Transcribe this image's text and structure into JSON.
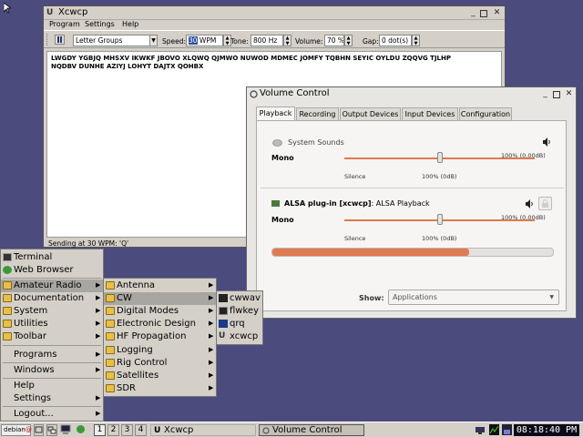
{
  "xcwcp": {
    "title": "Xcwcp",
    "menu": [
      "Program",
      "Settings",
      "Help"
    ],
    "toolbar": {
      "mode": "Letter Groups",
      "speed_label": "Speed:",
      "speed_value": "30 WPM",
      "tone_label": "Tone:",
      "tone_value": "800 Hz",
      "volume_label": "Volume:",
      "volume_value": "70 %",
      "gap_label": "Gap:",
      "gap_value": "0 dot(s)"
    },
    "text_line1": "LWGDY YGBJQ MHSXV IKWKF JBOVO XLQWQ QJMWO NUWOD MDMEC JOMFY TQBHN SEYIC OYLDU ZQQVG TJLHP",
    "text_line2": "NQDBV DUNHE AZIYJ LOHYT DAJTX QOHBX",
    "status": "Sending at 30 WPM: 'Q'"
  },
  "volume": {
    "title": "Volume Control",
    "tabs": [
      "Playback",
      "Recording",
      "Output Devices",
      "Input Devices",
      "Configuration"
    ],
    "system_sounds": "System Sounds",
    "mono1": "Mono",
    "level1": "100% (0.00dB)",
    "silence1": "Silence",
    "mark1": "100% (0dB)",
    "alsa_name": "ALSA plug-in [xcwcp]",
    "alsa_suffix": ": ALSA Playback",
    "mono2": "Mono",
    "level2": "100% (0.00dB)",
    "silence2": "Silence",
    "mark2": "100% (0dB)",
    "peak_level": 0.7,
    "show_label": "Show:",
    "show_value": "Applications"
  },
  "start_menu": {
    "items": [
      "Terminal",
      "Web Browser",
      "Amateur Radio",
      "Documentation",
      "System",
      "Utilities",
      "Toolbar",
      "Programs",
      "Windows",
      "Help",
      "Settings",
      "Logout..."
    ]
  },
  "radio_menu": {
    "items": [
      "Antenna",
      "CW",
      "Digital Modes",
      "Electronic Design",
      "HF Propagation",
      "Logging",
      "Rig Control",
      "Satellites",
      "SDR"
    ]
  },
  "cw_menu": {
    "items": [
      "cwwav",
      "flwkey",
      "qrq",
      "xcwcp"
    ]
  },
  "taskbar": {
    "start": "debian",
    "desktops": [
      "1",
      "2",
      "3",
      "4"
    ],
    "task1": "Xcwcp",
    "task2": "Volume Control",
    "clock": "08:18:40 PM"
  },
  "colors": {
    "desktop": "#4b4b7e",
    "accent": "#e07a50",
    "folder": "#e8c048"
  }
}
